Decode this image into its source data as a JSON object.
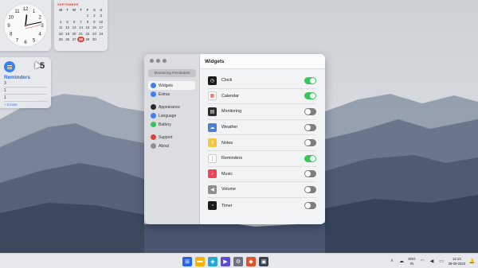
{
  "desktop": {
    "wallpaper": "misty-mountains"
  },
  "clock_widget": {
    "hours": [
      12,
      1,
      2,
      3,
      4,
      5,
      6,
      7,
      8,
      9,
      10,
      11
    ],
    "time": {
      "hour": 12,
      "minute": 13
    }
  },
  "calendar_widget": {
    "month": "SEPTEMBER",
    "weekdays": [
      "M",
      "T",
      "W",
      "T",
      "F",
      "S",
      "S"
    ],
    "weeks": [
      [
        "",
        "",
        "",
        "",
        "1",
        "2",
        "3"
      ],
      [
        "4",
        "5",
        "6",
        "7",
        "8",
        "9",
        "10"
      ],
      [
        "11",
        "12",
        "13",
        "14",
        "15",
        "16",
        "17"
      ],
      [
        "18",
        "19",
        "20",
        "21",
        "22",
        "23",
        "24"
      ],
      [
        "25",
        "26",
        "27",
        "28",
        "29",
        "30",
        ""
      ]
    ],
    "today": "28",
    "today_color": "#e0443a"
  },
  "reminders_widget": {
    "count": "5",
    "title": "Reminders",
    "items": [
      "3",
      "1",
      "1"
    ],
    "more": "+ 3 more"
  },
  "settings": {
    "search_label": "Monitoring Reminders",
    "sidebar": [
      {
        "label": "Widgets",
        "icon": "widgets-icon",
        "color": "#3b82f6",
        "active": true,
        "group": 1
      },
      {
        "label": "Extras",
        "icon": "extras-icon",
        "color": "#3b82f6",
        "active": false,
        "group": 1
      },
      {
        "label": "Appearance",
        "icon": "appearance-icon",
        "color": "#2b2b2b",
        "active": false,
        "group": 2
      },
      {
        "label": "Language",
        "icon": "language-icon",
        "color": "#3b82f6",
        "active": false,
        "group": 2
      },
      {
        "label": "Battery",
        "icon": "battery-icon",
        "color": "#34c759",
        "active": false,
        "group": 2
      },
      {
        "label": "Support",
        "icon": "support-icon",
        "color": "#e0443a",
        "active": false,
        "group": 3
      },
      {
        "label": "About",
        "icon": "about-icon",
        "color": "#8e8e93",
        "active": false,
        "group": 3
      }
    ],
    "panel_title": "Widgets",
    "widgets": [
      {
        "label": "Clock",
        "icon": "clock-icon",
        "color": "#1c1c1e",
        "on": true
      },
      {
        "label": "Calendar",
        "icon": "calendar-icon",
        "color": "#ffffff",
        "on": true
      },
      {
        "label": "Monitoring",
        "icon": "monitoring-icon",
        "color": "#2b2b2b",
        "on": false
      },
      {
        "label": "Weather",
        "icon": "weather-icon",
        "color": "#4a7fd4",
        "on": false
      },
      {
        "label": "Notes",
        "icon": "notes-icon",
        "color": "#f5c542",
        "on": false
      },
      {
        "label": "Reminders",
        "icon": "reminders-icon",
        "color": "#ffffff",
        "on": true
      },
      {
        "label": "Music",
        "icon": "music-icon",
        "color": "#f0445a",
        "on": false
      },
      {
        "label": "Volume",
        "icon": "volume-icon",
        "color": "#8e8e93",
        "on": false
      },
      {
        "label": "Timer",
        "icon": "timer-icon",
        "color": "#1c1c1e",
        "on": false
      }
    ]
  },
  "taskbar": {
    "apps": [
      {
        "name": "start-icon",
        "color": "#2563eb"
      },
      {
        "name": "file-explorer-icon",
        "color": "#f5b301"
      },
      {
        "name": "photos-icon",
        "color": "#2aa6d6"
      },
      {
        "name": "media-player-icon",
        "color": "#5b4bd8"
      },
      {
        "name": "settings-app-icon",
        "color": "#6b7280"
      },
      {
        "name": "brave-browser-icon",
        "color": "#e2532d"
      },
      {
        "name": "terminal-icon",
        "color": "#374151"
      }
    ],
    "language_top": "ENG",
    "language_bottom": "IN",
    "time": "12:13",
    "date": "28-09-2023"
  }
}
